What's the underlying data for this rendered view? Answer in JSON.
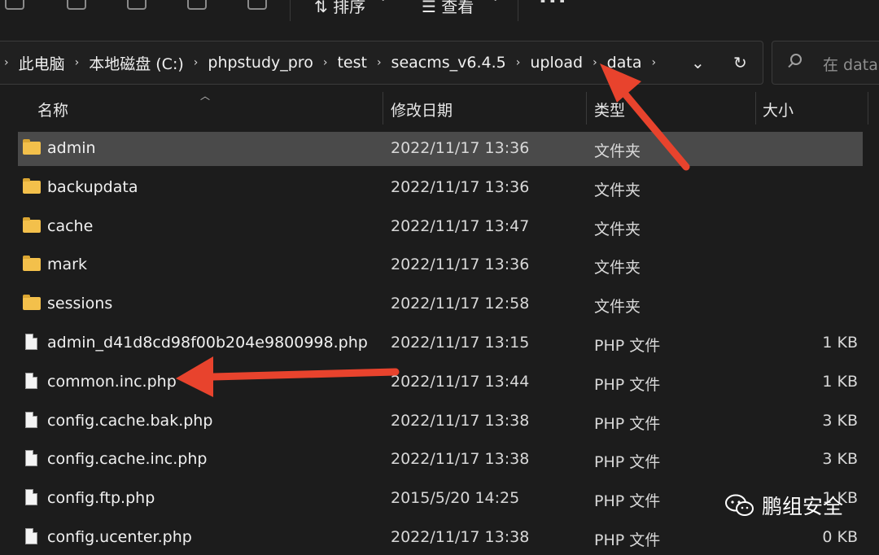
{
  "toolbar": {
    "sort_label": "排序",
    "view_label": "查看",
    "more_label": "..."
  },
  "address_bar": {
    "crumbs": [
      "此电脑",
      "本地磁盘 (C:)",
      "phpstudy_pro",
      "test",
      "seacms_v6.4.5",
      "upload",
      "data"
    ],
    "dropdown_icon": "chevron-down-icon",
    "refresh_icon": "refresh-icon"
  },
  "search": {
    "placeholder": "在 data"
  },
  "columns": {
    "name": "名称",
    "date": "修改日期",
    "type": "类型",
    "size": "大小"
  },
  "files": [
    {
      "name": "admin",
      "date": "2022/11/17 13:36",
      "type": "文件夹",
      "size": "",
      "kind": "folder",
      "selected": true
    },
    {
      "name": "backupdata",
      "date": "2022/11/17 13:36",
      "type": "文件夹",
      "size": "",
      "kind": "folder"
    },
    {
      "name": "cache",
      "date": "2022/11/17 13:47",
      "type": "文件夹",
      "size": "",
      "kind": "folder"
    },
    {
      "name": "mark",
      "date": "2022/11/17 13:36",
      "type": "文件夹",
      "size": "",
      "kind": "folder"
    },
    {
      "name": "sessions",
      "date": "2022/11/17 12:58",
      "type": "文件夹",
      "size": "",
      "kind": "folder"
    },
    {
      "name": "admin_d41d8cd98f00b204e9800998.php",
      "date": "2022/11/17 13:15",
      "type": "PHP 文件",
      "size": "1 KB",
      "kind": "file"
    },
    {
      "name": "common.inc.php",
      "date": "2022/11/17 13:44",
      "type": "PHP 文件",
      "size": "1 KB",
      "kind": "file"
    },
    {
      "name": "config.cache.bak.php",
      "date": "2022/11/17 13:38",
      "type": "PHP 文件",
      "size": "3 KB",
      "kind": "file"
    },
    {
      "name": "config.cache.inc.php",
      "date": "2022/11/17 13:38",
      "type": "PHP 文件",
      "size": "3 KB",
      "kind": "file"
    },
    {
      "name": "config.ftp.php",
      "date": "2015/5/20 14:25",
      "type": "PHP 文件",
      "size": "1 KB",
      "kind": "file"
    },
    {
      "name": "config.ucenter.php",
      "date": "2022/11/17 13:38",
      "type": "PHP 文件",
      "size": "0 KB",
      "kind": "file"
    }
  ],
  "annotation_color": "#e8432d",
  "watermark": {
    "text": "鹏组安全"
  }
}
